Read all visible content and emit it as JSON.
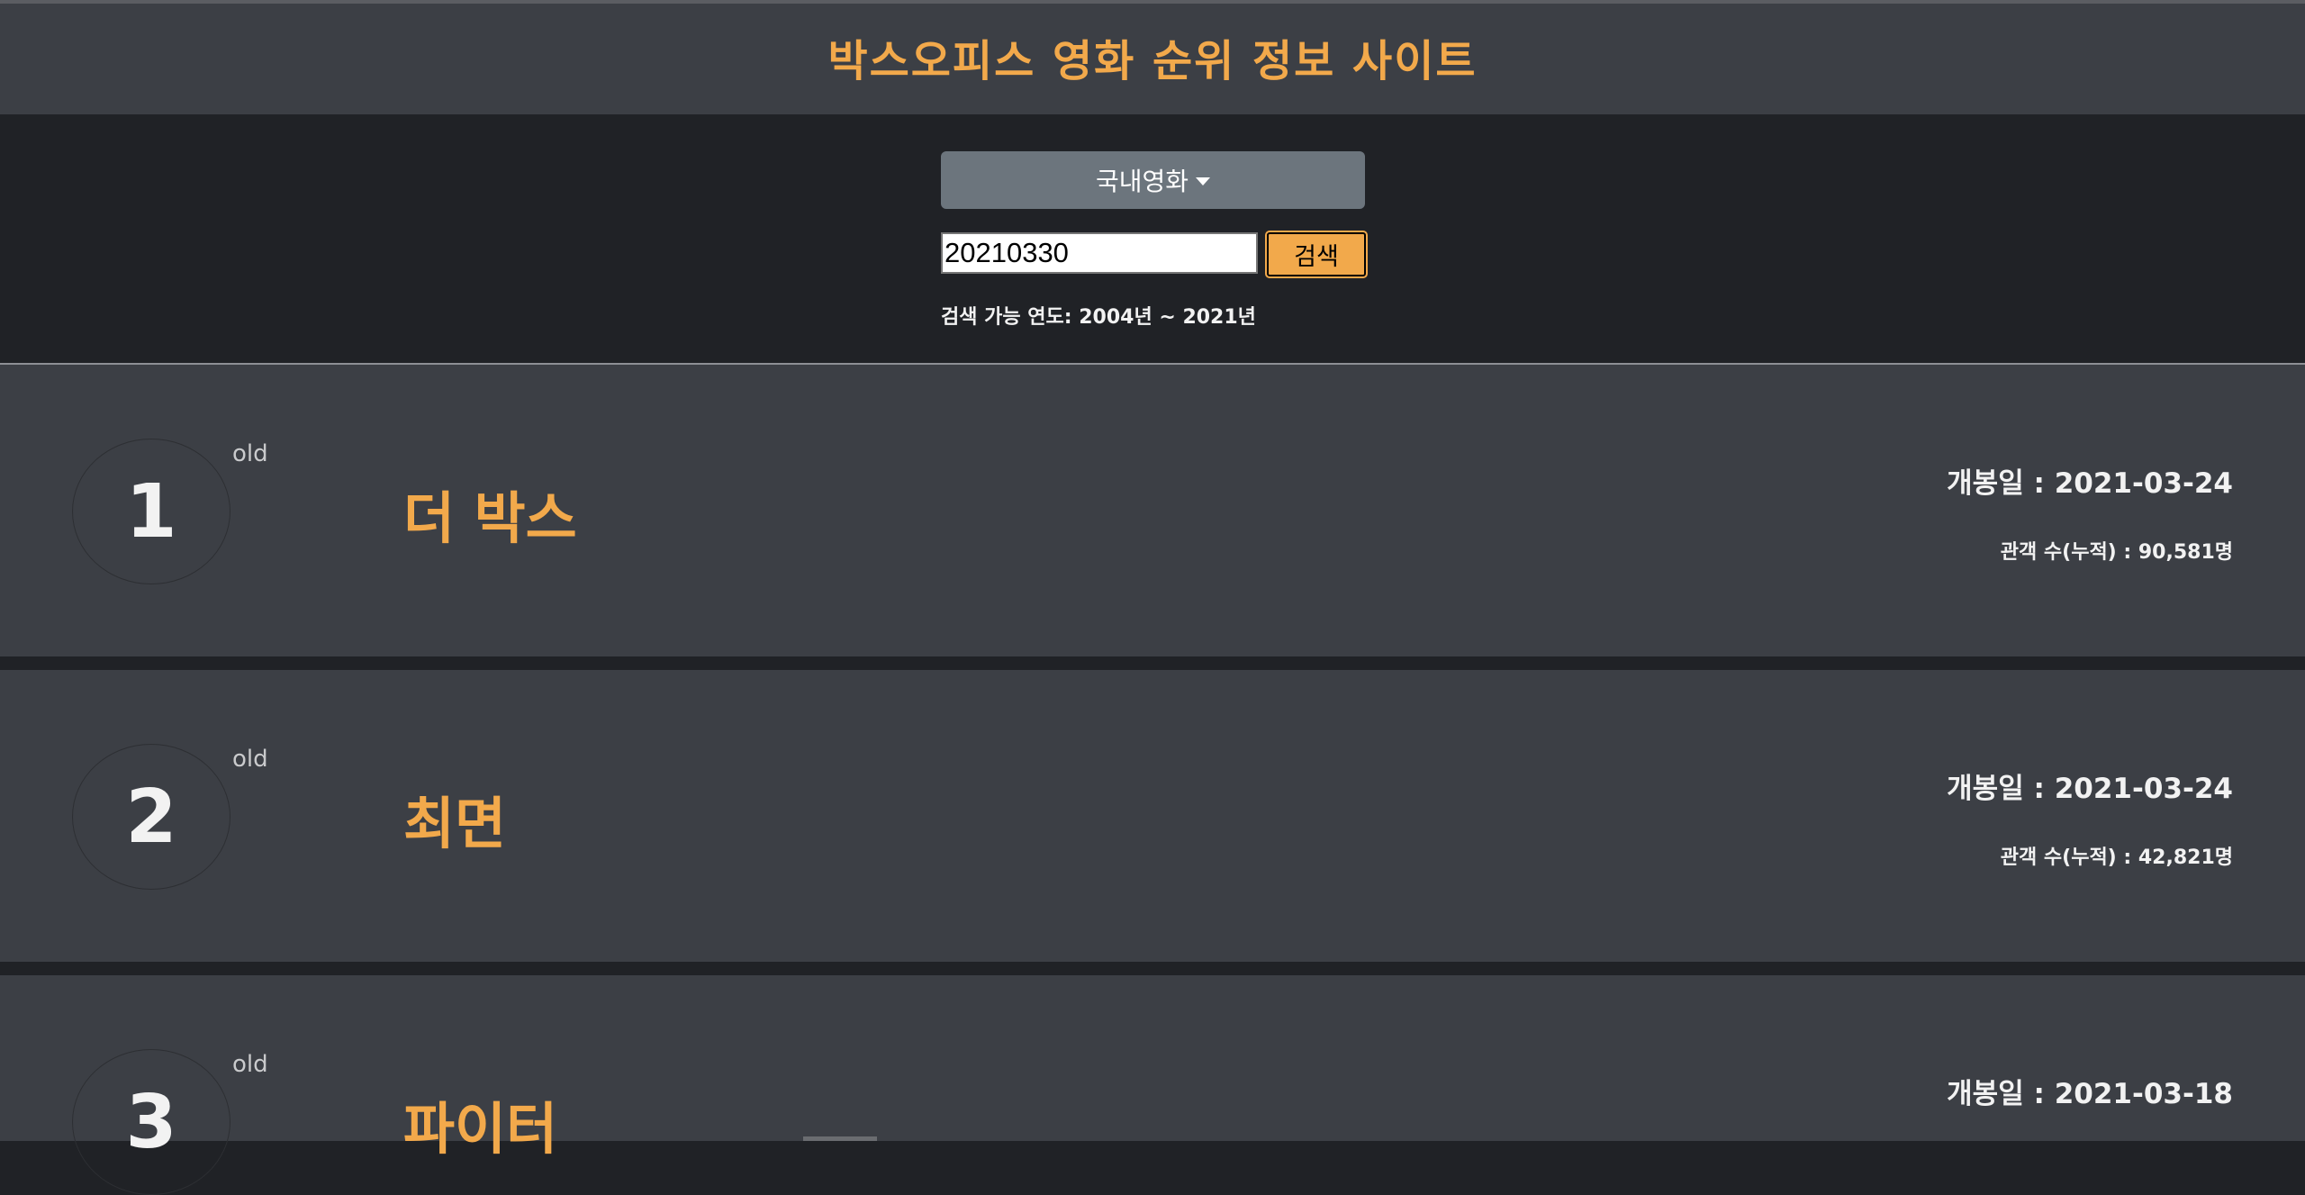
{
  "header": {
    "title": "박스오피스 영화 순위 정보 사이트"
  },
  "search": {
    "dropdown_label": "국내영화",
    "date_value": "20210330",
    "button_label": "검색",
    "hint": "검색 가능 연도: 2004년 ~ 2021년"
  },
  "movies": [
    {
      "rank": "1",
      "tag": "old",
      "title": "더 박스",
      "open_date": "개봉일 : 2021-03-24",
      "audience": "관객 수(누적) : 90,581명"
    },
    {
      "rank": "2",
      "tag": "old",
      "title": "최면",
      "open_date": "개봉일 : 2021-03-24",
      "audience": "관객 수(누적) : 42,821명"
    },
    {
      "rank": "3",
      "tag": "old",
      "title": "파이터",
      "open_date": "개봉일 : 2021-03-18",
      "audience": ""
    }
  ],
  "colors": {
    "accent": "#f2a94b",
    "header_bg": "#3c3f45",
    "page_bg": "#202226",
    "dropdown_bg": "#6c757d"
  }
}
